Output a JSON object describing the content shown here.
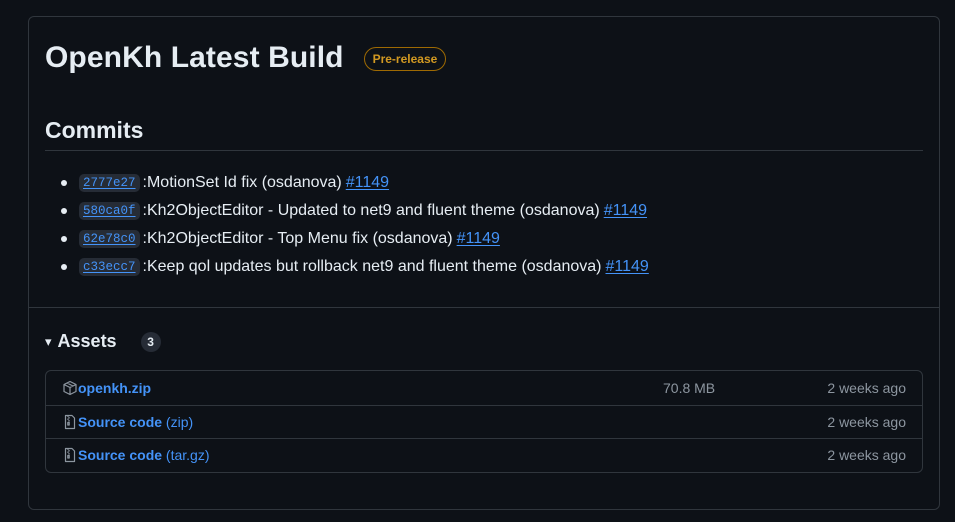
{
  "release": {
    "title": "OpenKh Latest Build",
    "badge": "Pre-release"
  },
  "commits": {
    "heading": "Commits",
    "items": [
      {
        "sha": "2777e27",
        "sep": " : ",
        "message": "MotionSet Id fix (osdanova)",
        "pr": "#1149"
      },
      {
        "sha": "580ca0f",
        "sep": " : ",
        "message": "Kh2ObjectEditor - Updated to net9 and fluent theme (osdanova)",
        "pr": "#1149"
      },
      {
        "sha": "62e78c0",
        "sep": " : ",
        "message": "Kh2ObjectEditor - Top Menu fix (osdanova)",
        "pr": "#1149"
      },
      {
        "sha": "c33ecc7",
        "sep": " : ",
        "message": "Keep qol updates but rollback net9 and fluent theme (osdanova)",
        "pr": "#1149"
      }
    ]
  },
  "assets": {
    "caret": "▾",
    "heading": "Assets",
    "count": "3",
    "items": [
      {
        "icon": "package-icon",
        "name": "openkh.zip",
        "suffix": "",
        "size": "70.8 MB",
        "date": "2 weeks ago"
      },
      {
        "icon": "file-zip-icon",
        "name": "Source code",
        "suffix": " (zip)",
        "size": "",
        "date": "2 weeks ago"
      },
      {
        "icon": "file-zip-icon",
        "name": "Source code",
        "suffix": " (tar.gz)",
        "size": "",
        "date": "2 weeks ago"
      }
    ]
  },
  "colors": {
    "background": "#0d1117",
    "border": "#30363d",
    "link": "#4493f8",
    "badge": "#d29922",
    "muted": "#8d96a0"
  }
}
